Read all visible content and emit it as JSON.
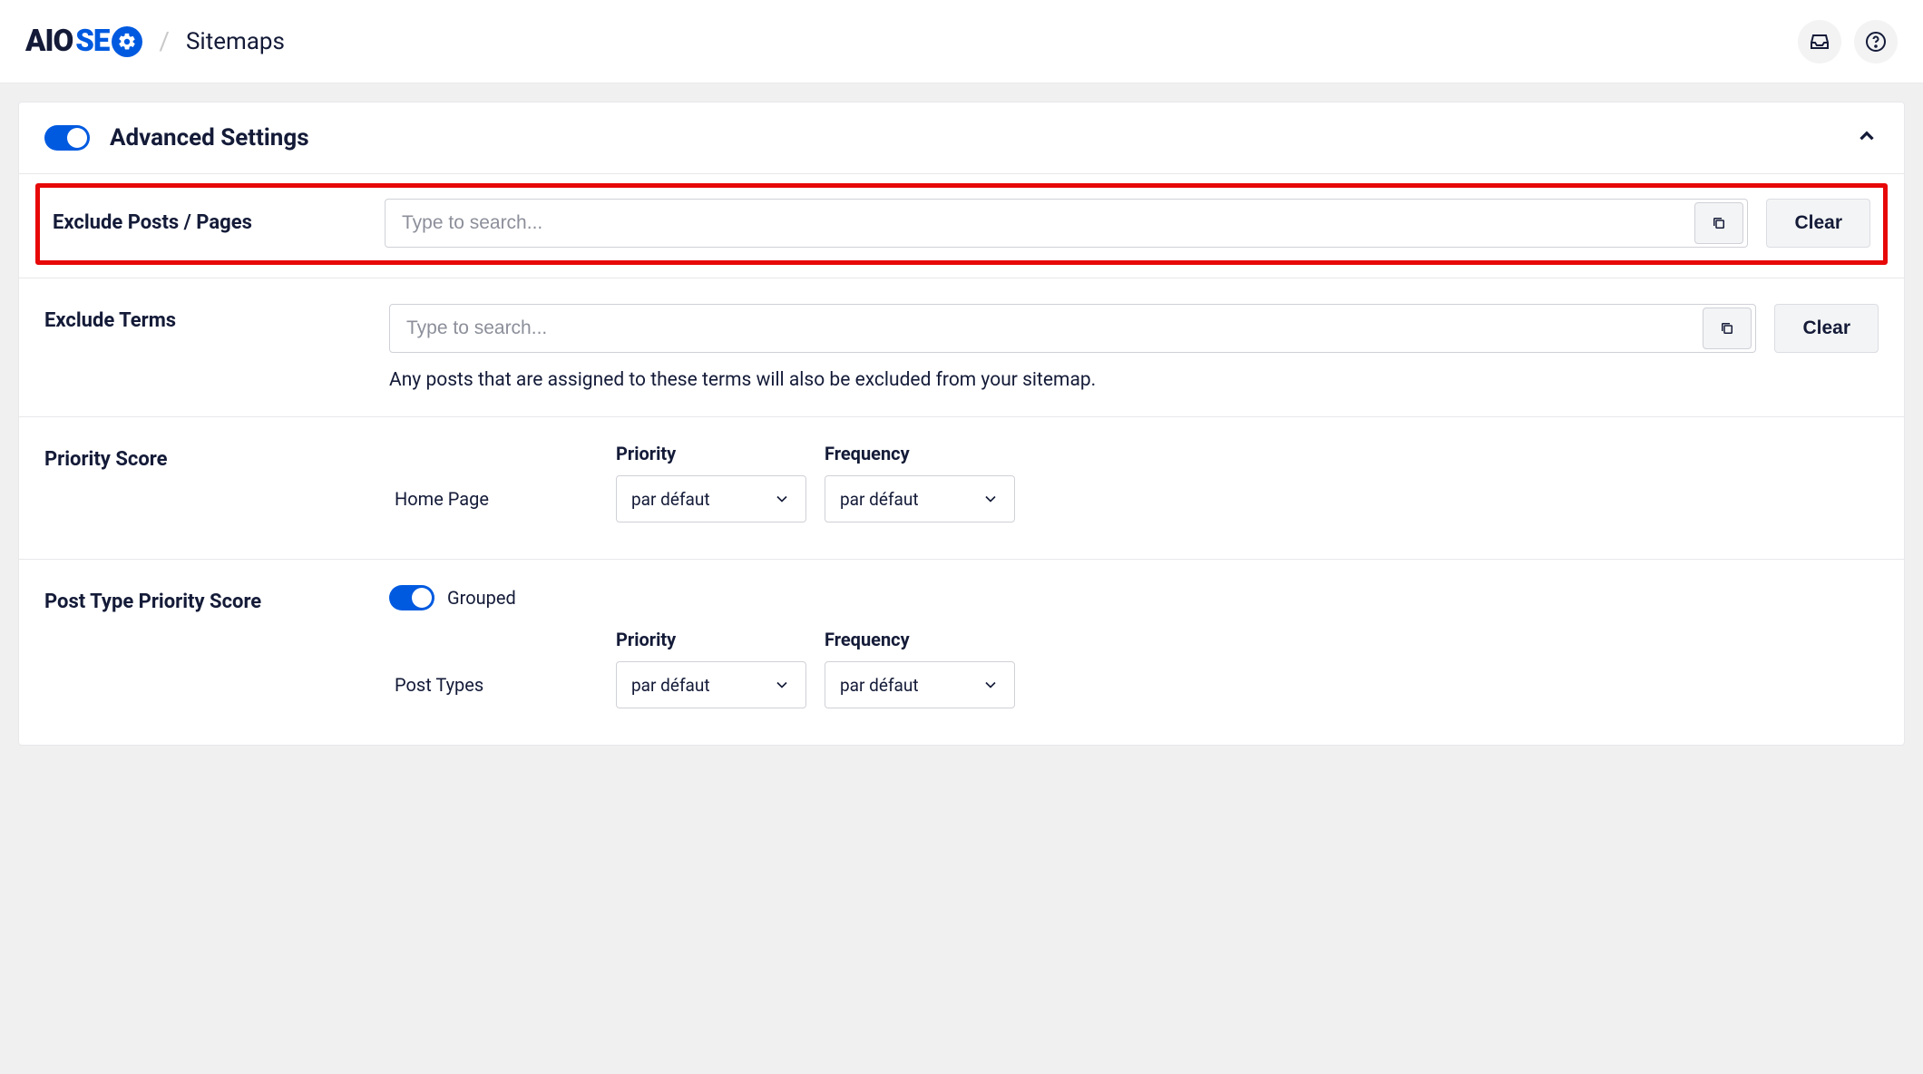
{
  "header": {
    "breadcrumb": "Sitemaps"
  },
  "card": {
    "title": "Advanced Settings"
  },
  "exclude_posts": {
    "label": "Exclude Posts / Pages",
    "placeholder": "Type to search...",
    "clear": "Clear"
  },
  "exclude_terms": {
    "label": "Exclude Terms",
    "placeholder": "Type to search...",
    "clear": "Clear",
    "helper": "Any posts that are assigned to these terms will also be excluded from your sitemap."
  },
  "priority_score": {
    "label": "Priority Score",
    "cols": {
      "priority": "Priority",
      "frequency": "Frequency"
    },
    "rows": [
      {
        "label": "Home Page",
        "priority": "par défaut",
        "frequency": "par défaut"
      }
    ]
  },
  "post_type_priority": {
    "label": "Post Type Priority Score",
    "grouped_label": "Grouped",
    "cols": {
      "priority": "Priority",
      "frequency": "Frequency"
    },
    "rows": [
      {
        "label": "Post Types",
        "priority": "par défaut",
        "frequency": "par défaut"
      }
    ]
  }
}
